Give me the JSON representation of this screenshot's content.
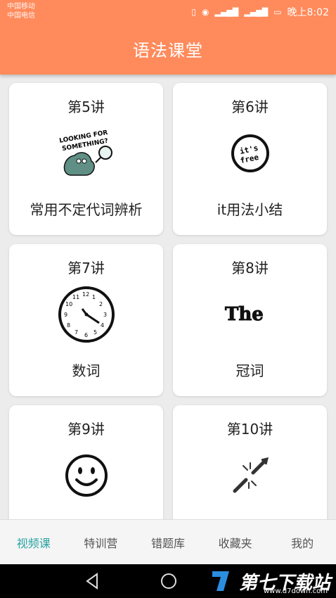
{
  "status": {
    "carrier1": "中国移动",
    "carrier2": "中国电信",
    "time": "晚上8:02"
  },
  "header": {
    "title": "语法课堂"
  },
  "lessons": [
    {
      "num": "第5讲",
      "topic": "常用不定代词辨析",
      "icon": "magnifier-creature-icon"
    },
    {
      "num": "第6讲",
      "topic": "it用法小结",
      "icon": "its-free-stamp-icon"
    },
    {
      "num": "第7讲",
      "topic": "数词",
      "icon": "clock-icon"
    },
    {
      "num": "第8讲",
      "topic": "冠词",
      "icon": "the-text-icon"
    },
    {
      "num": "第9讲",
      "topic": "",
      "icon": "smiley-face-icon"
    },
    {
      "num": "第10讲",
      "topic": "",
      "icon": "broken-chain-icon"
    }
  ],
  "tabs": [
    {
      "label": "视频课",
      "active": true
    },
    {
      "label": "特训营",
      "active": false
    },
    {
      "label": "错题库",
      "active": false
    },
    {
      "label": "收藏夹",
      "active": false
    },
    {
      "label": "我的",
      "active": false
    }
  ],
  "watermark": {
    "text": "第七下载站",
    "sub": "www.d7down.com"
  },
  "colors": {
    "accent": "#ff8a5b",
    "tab_active": "#2aa3a3"
  }
}
